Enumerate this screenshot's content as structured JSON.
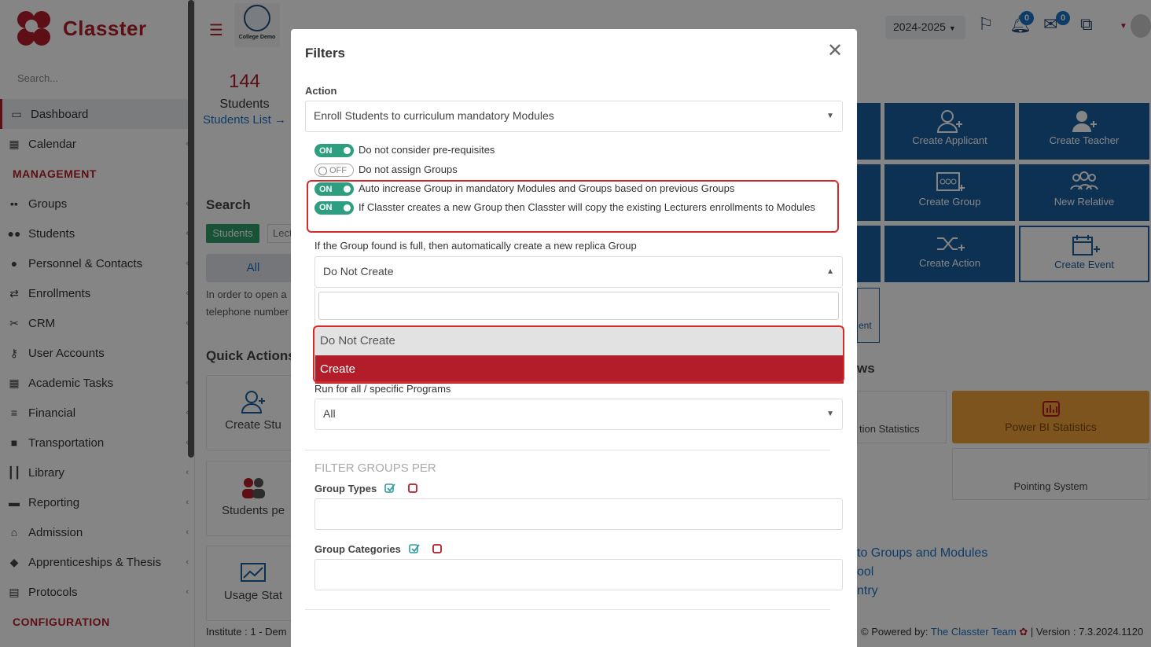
{
  "app": {
    "name": "Classter",
    "college": "College Demo",
    "year": "2024-2025"
  },
  "sidebar": {
    "search_placeholder": "Search...",
    "items": [
      {
        "label": "Dashboard",
        "icon": "monitor-icon"
      },
      {
        "label": "Calendar",
        "icon": "calendar-icon"
      },
      {
        "section": "MANAGEMENT"
      },
      {
        "label": "Groups",
        "icon": "groups-icon"
      },
      {
        "label": "Students",
        "icon": "students-icon"
      },
      {
        "label": "Personnel & Contacts",
        "icon": "person-icon"
      },
      {
        "label": "Enrollments",
        "icon": "swap-icon"
      },
      {
        "label": "CRM",
        "icon": "crm-icon"
      },
      {
        "label": "User Accounts",
        "icon": "key-icon"
      },
      {
        "label": "Academic Tasks",
        "icon": "grid-icon"
      },
      {
        "label": "Financial",
        "icon": "coins-icon"
      },
      {
        "label": "Transportation",
        "icon": "bus-icon"
      },
      {
        "label": "Library",
        "icon": "books-icon"
      },
      {
        "label": "Reporting",
        "icon": "printer-icon"
      },
      {
        "label": "Admission",
        "icon": "building-icon"
      },
      {
        "label": "Apprenticeships & Thesis",
        "icon": "box-icon"
      },
      {
        "label": "Protocols",
        "icon": "protocol-icon"
      },
      {
        "section": "CONFIGURATION"
      }
    ]
  },
  "topbar": {
    "notifications": "0",
    "messages": "0"
  },
  "dashboard": {
    "students_count": "144",
    "students_label": "Students",
    "students_link": "Students List",
    "search_title": "Search",
    "tab_students": "Students",
    "tab_lect": "Lect",
    "all_button": "All",
    "hint": "In order to open a telephone number",
    "quick_actions_title": "Quick Actions",
    "qa_cards": [
      "Create Stu",
      "Students pe",
      "Usage Stat"
    ],
    "institute": "Institute : 1 - Dem",
    "tiles": [
      "Create Applicant",
      "Create Teacher",
      "Create Group",
      "New Relative",
      "Create Action",
      "Create Event"
    ],
    "tile_edge": "ent",
    "views_title": "ws",
    "partial_stat": "tion Statistics",
    "power_bi": "Power BI Statistics",
    "pointing": "Pointing System",
    "links": [
      "to Groups and Modules",
      "ool",
      "ntry"
    ],
    "powered_by": "Powered by:",
    "powered_team": "The Classter Team",
    "version": "| Version : 7.3.2024.1120"
  },
  "modal": {
    "title": "Filters",
    "action_label": "Action",
    "action_value": "Enroll Students to curriculum mandatory Modules",
    "toggles": [
      {
        "state": "ON",
        "label": "Do not consider pre-requisites"
      },
      {
        "state": "OFF",
        "label": "Do not assign Groups"
      },
      {
        "state": "ON",
        "label": "Auto increase Group in mandatory Modules and Groups based on previous Groups"
      },
      {
        "state": "ON",
        "label": "If Classter creates a new Group then Classter will copy the existing Lecturers enrollments to Modules"
      }
    ],
    "replica_label": "If the Group found is full, then automatically create a new replica Group",
    "replica_value": "Do Not Create",
    "dropdown_search": "",
    "options": [
      "Do Not Create",
      "Create"
    ],
    "programs_label": "Run for all / specific Programs",
    "programs_value": "All",
    "filter_title": "FILTER GROUPS PER",
    "group_types_label": "Group Types",
    "group_categories_label": "Group Categories"
  }
}
